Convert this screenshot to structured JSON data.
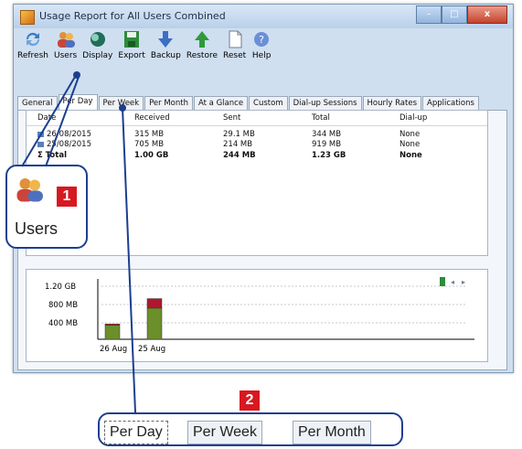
{
  "window": {
    "title": "Usage Report for All Users Combined"
  },
  "toolbar": {
    "refresh": "Refresh",
    "users": "Users",
    "display": "Display",
    "export": "Export",
    "backup": "Backup",
    "restore": "Restore",
    "reset": "Reset",
    "help": "Help"
  },
  "tabs": [
    "General",
    "Per Day",
    "Per Week",
    "Per Month",
    "At a Glance",
    "Custom",
    "Dial-up Sessions",
    "Hourly Rates",
    "Applications"
  ],
  "table": {
    "headers": [
      "Date",
      "Received",
      "Sent",
      "Total",
      "Dial-up"
    ],
    "rows": [
      [
        "26/08/2015",
        "315 MB",
        "29.1 MB",
        "344 MB",
        "None"
      ],
      [
        "25/08/2015",
        "705 MB",
        "214 MB",
        "919 MB",
        "None"
      ]
    ],
    "total": [
      "Total",
      "1.00 GB",
      "244 MB",
      "1.23 GB",
      "None"
    ]
  },
  "chart_data": {
    "type": "bar",
    "categories": [
      "26 Aug",
      "25 Aug"
    ],
    "series": [
      {
        "values": [
          315,
          705
        ]
      },
      {
        "values": [
          29.1,
          214
        ]
      }
    ],
    "y_tick_labels": [
      "1.20 GB",
      "800 MB",
      "400 MB"
    ],
    "colors": [
      "#6b8f2a",
      "#b0172f"
    ]
  },
  "callouts": {
    "one": {
      "number": "1",
      "label": "Users"
    },
    "two": {
      "number": "2",
      "tabs": [
        "Per Day",
        "Per Week",
        "Per Month"
      ]
    }
  }
}
